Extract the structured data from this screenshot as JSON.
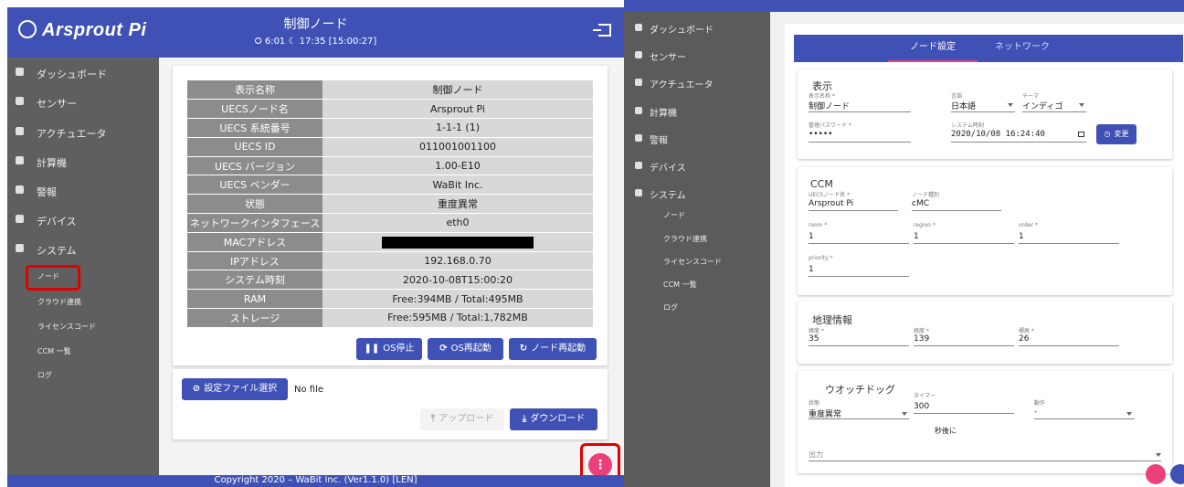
{
  "left": {
    "header": {
      "logo": "Arsprout Pi",
      "title": "制御ノード",
      "time": "⭘ 6:01 ☾ 17:35 [15:00:27]"
    },
    "sidebar": {
      "items": [
        "ダッシュボード",
        "センサー",
        "アクチュエータ",
        "計算機",
        "警報",
        "デバイス",
        "システム"
      ],
      "sub_items": [
        "ノード",
        "クラウド連携",
        "ライセンスコード",
        "CCM 一覧",
        "ログ"
      ]
    },
    "info_table": [
      {
        "key": "表示名称",
        "value": "制御ノード"
      },
      {
        "key": "UECSノード名",
        "value": "Arsprout Pi"
      },
      {
        "key": "UECS 系統番号",
        "value": "1-1-1 (1)"
      },
      {
        "key": "UECS ID",
        "value": "011001001100"
      },
      {
        "key": "UECS バージョン",
        "value": "1.00-E10"
      },
      {
        "key": "UECS ベンダー",
        "value": "WaBit Inc."
      },
      {
        "key": "状態",
        "value": "重度異常"
      },
      {
        "key": "ネットワークインタフェース",
        "value": "eth0"
      },
      {
        "key": "MACアドレス",
        "value": ""
      },
      {
        "key": "IPアドレス",
        "value": "192.168.0.70"
      },
      {
        "key": "システム時刻",
        "value": "2020-10-08T15:00:20"
      },
      {
        "key": "RAM",
        "value": "Free:394MB / Total:495MB"
      },
      {
        "key": "ストレージ",
        "value": "Free:595MB / Total:1,782MB"
      }
    ],
    "buttons": {
      "os_stop": "OS停止",
      "os_reboot": "OS再起動",
      "node_reboot": "ノード再起動",
      "select_file": "設定ファイル選択",
      "upload": "アップロード",
      "download": "ダウンロード"
    },
    "file_status": "No file",
    "footer": "Copyright 2020 – WaBit Inc. (Ver1.1.0) [LEN]"
  },
  "right": {
    "tabs": [
      "ノード設定",
      "ネットワーク"
    ],
    "sidebar": {
      "items": [
        "ダッシュボード",
        "センサー",
        "アクチュエータ",
        "計算機",
        "警報",
        "デバイス",
        "システム"
      ],
      "sub_items": [
        "ノード",
        "クラウド連携",
        "ライセンスコード",
        "CCM 一覧",
        "ログ"
      ]
    },
    "display": {
      "title": "表示",
      "name_label": "表示名称 *",
      "name_value": "制御ノード",
      "lang_label": "言語",
      "lang_value": "日本語",
      "theme_label": "テーマ",
      "theme_value": "インディゴ",
      "pass_label": "管理パスワード *",
      "pass_value": "•••••",
      "time_label": "システム時刻",
      "time_value": "2020/10/08 16:24:40",
      "change_button": "変更"
    },
    "ccm": {
      "title": "CCM",
      "node_label": "UECSノード名 *",
      "node_value": "Arsprout Pi",
      "type_label": "ノード種別",
      "type_value": "cMC",
      "room_label": "room *",
      "room_value": "1",
      "region_label": "region *",
      "region_value": "1",
      "order_label": "order *",
      "order_value": "1",
      "priority_label": "priority *",
      "priority_value": "1"
    },
    "geo": {
      "title": "地理情報",
      "lat_label": "緯度 *",
      "lat_value": "35",
      "lon_label": "経度 *",
      "lon_value": "139",
      "alt_label": "標高 *",
      "alt_value": "26"
    },
    "watchdog": {
      "title": "ウオッチドッグ",
      "state_label": "状態",
      "state_value": "重度異常",
      "timer_label": "タイマー",
      "timer_value": "300",
      "timer_suffix": "秒後に",
      "action_label": "動作",
      "action_value": "-",
      "output_label": "出力"
    }
  }
}
